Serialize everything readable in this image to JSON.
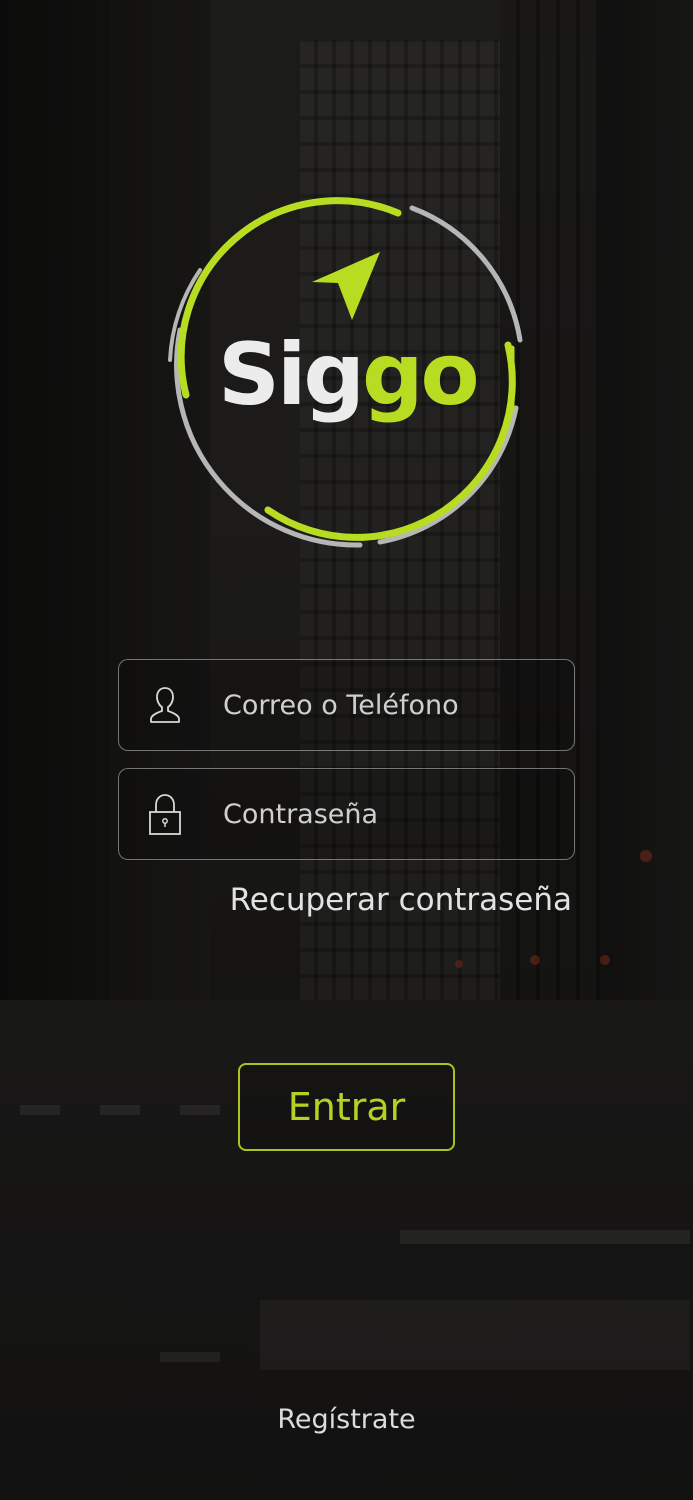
{
  "logo": {
    "text_part1": "Sig",
    "text_part2": "go",
    "brand_green": "#b8dc22",
    "ring_gray": "#b6b6b6"
  },
  "login": {
    "email_placeholder": "Correo o Teléfono",
    "email_value": "",
    "email_icon": "user-icon",
    "password_placeholder": "Contraseña",
    "password_value": "",
    "password_icon": "lock-icon",
    "recover_label": "Recuperar contraseña",
    "enter_label": "Entrar",
    "register_label": "Regístrate"
  },
  "colors": {
    "accent": "#b4d124",
    "text": "#e2e2e2",
    "field_border": "#c8c8c8"
  }
}
